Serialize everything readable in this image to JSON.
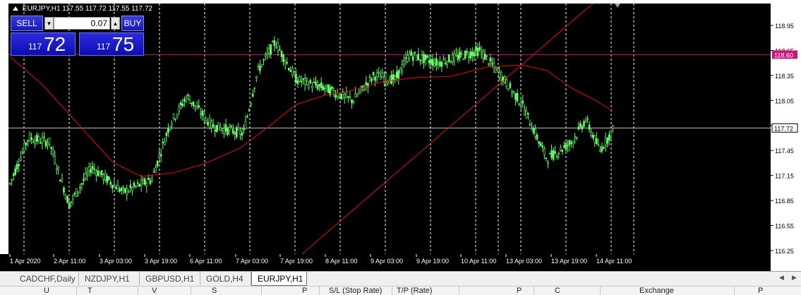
{
  "window": {
    "symbol_info": "EURJPY,H1  117.55 117.72 117.55 117.72"
  },
  "trade_panel": {
    "sell_label": "SELL",
    "buy_label": "BUY",
    "lot_value": "0.07",
    "sell_price_small": "117",
    "sell_price_big": "72",
    "buy_price_small": "117",
    "buy_price_big": "75"
  },
  "price_axis": {
    "labels": [
      "118.95",
      "118.65",
      "118.35",
      "118.05",
      "117.75",
      "117.45",
      "117.15",
      "116.85",
      "116.55",
      "116.25"
    ],
    "marker_pink": "118.60",
    "marker_current": "117.72",
    "pink_color": "#c8177c"
  },
  "time_axis": {
    "labels": [
      "1 Apr 2020",
      "2 Apr 11:00",
      "3 Apr 03:00",
      "3 Apr 19:00",
      "6 Apr 11:00",
      "7 Apr 03:00",
      "7 Apr 19:00",
      "8 Apr 11:00",
      "9 Apr 03:00",
      "9 Apr 19:00",
      "10 Apr 11:00",
      "13 Apr 03:00",
      "13 Apr 19:00",
      "14 Apr 11:00"
    ]
  },
  "tabs": [
    {
      "label": "CADCHF,Daily",
      "active": false
    },
    {
      "label": "NZDJPY,H1",
      "active": false
    },
    {
      "label": "GBPUSD,H1",
      "active": false
    },
    {
      "label": "GOLD,H4",
      "active": false
    },
    {
      "label": "EURJPY,H1",
      "active": true
    }
  ],
  "terminal_columns": [
    "U",
    "T",
    "V",
    "S",
    "P",
    "S/L (Stop Rate)",
    "T/P (Rate)",
    "P",
    "C",
    "Exchange",
    "P"
  ],
  "colors": {
    "chart_bg": "#000000",
    "candles": "#66ff66",
    "moving_average": "#e01010",
    "trendline": "#e01010",
    "grid": "#ffffff"
  }
}
